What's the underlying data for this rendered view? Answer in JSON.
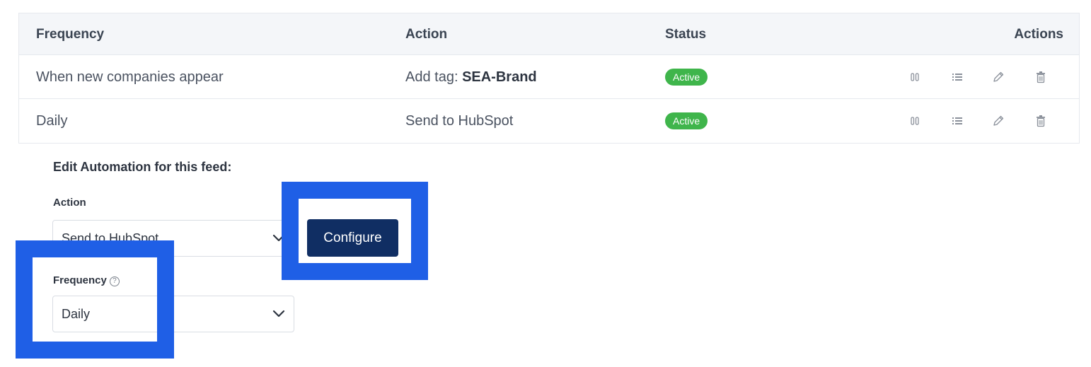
{
  "table": {
    "headers": {
      "frequency": "Frequency",
      "action": "Action",
      "status": "Status",
      "actions": "Actions"
    },
    "rows": [
      {
        "frequency": "When new companies appear",
        "action_prefix": "Add tag: ",
        "action_bold": "SEA-Brand",
        "status": "Active"
      },
      {
        "frequency": "Daily",
        "action_prefix": "Send to HubSpot",
        "action_bold": "",
        "status": "Active"
      }
    ],
    "row_action_icons": [
      "pause-icon",
      "list-icon",
      "pencil-icon",
      "trash-icon"
    ]
  },
  "edit": {
    "title": "Edit Automation for this feed:",
    "action_label": "Action",
    "action_value": "Send to HubSpot",
    "configure_label": "Configure",
    "frequency_label": "Frequency",
    "frequency_help": "?",
    "frequency_value": "Daily"
  },
  "colors": {
    "highlight": "#1f5fe6",
    "active_badge": "#3fb54b",
    "configure_button": "#102e63"
  }
}
